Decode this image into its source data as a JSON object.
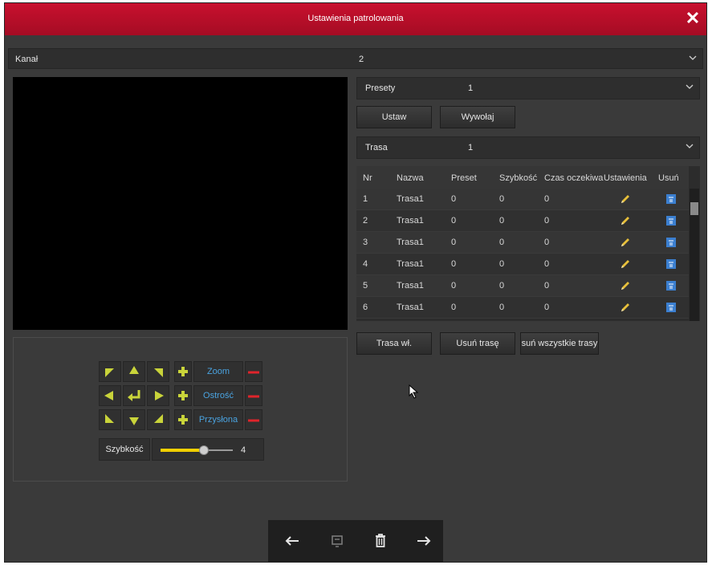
{
  "dialog": {
    "title": "Ustawienia patrolowania"
  },
  "channel": {
    "label": "Kanał",
    "value": "2"
  },
  "presets": {
    "label": "Presety",
    "value": "1"
  },
  "buttons": {
    "set": "Ustaw",
    "call": "Wywołaj",
    "route_on": "Trasa wł.",
    "delete_route": "Usuń trasę",
    "delete_all": "Usuń wszystkie trasy"
  },
  "route": {
    "label": "Trasa",
    "value": "1"
  },
  "table": {
    "headers": [
      "Nr",
      "Nazwa",
      "Preset",
      "Szybkość",
      "Czas oczekiwania",
      "Ustawienia",
      "Usuń"
    ],
    "rows": [
      [
        "1",
        "Trasa1",
        "0",
        "0",
        "0"
      ],
      [
        "2",
        "Trasa1",
        "0",
        "0",
        "0"
      ],
      [
        "3",
        "Trasa1",
        "0",
        "0",
        "0"
      ],
      [
        "4",
        "Trasa1",
        "0",
        "0",
        "0"
      ],
      [
        "5",
        "Trasa1",
        "0",
        "0",
        "0"
      ],
      [
        "6",
        "Trasa1",
        "0",
        "0",
        "0"
      ]
    ]
  },
  "ptz": {
    "zoom": "Zoom",
    "focus": "Ostrość",
    "iris": "Przysłona",
    "speed_label": "Szybkość",
    "speed_value": "4",
    "speed_level": 0.6
  },
  "colors": {
    "accent": "#c8102e",
    "arrow": "#c9d43a",
    "plus": "#c9d43a",
    "minus": "#e0242b",
    "link": "#4aa3e0",
    "slider": "#f2d000"
  },
  "icons": [
    "close-icon",
    "chevron-down-icon",
    "pencil-icon",
    "trash-icon",
    "arrow-left-icon",
    "screen-icon",
    "trash-bin-icon",
    "arrow-right-icon"
  ]
}
